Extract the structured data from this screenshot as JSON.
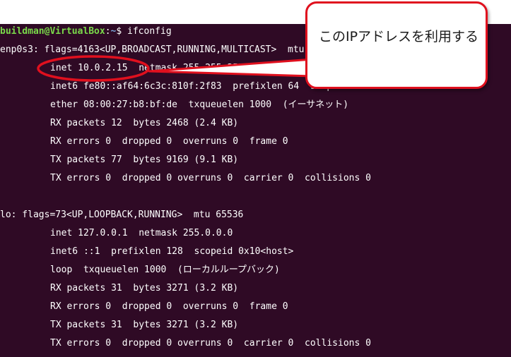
{
  "terminal": {
    "prompt_user": "buildman@VirtualBox",
    "prompt_sep": ":",
    "prompt_path": "~",
    "prompt_symbol": "$ ",
    "command": "ifconfig",
    "lines": [
      "enp0s3: flags=4163<UP,BROADCAST,RUNNING,MULTICAST>  mtu 1500",
      "inet 10.0.2.15  netmask 255.255.255.0  broadcast 10.0.2.255",
      "inet6 fe80::af64:6c3c:810f:2f83  prefixlen 64  scopeid 0x20<link>",
      "ether 08:00:27:b8:bf:de  txqueuelen 1000  (イーサネット)",
      "RX packets 12  bytes 2468 (2.4 KB)",
      "RX errors 0  dropped 0  overruns 0  frame 0",
      "TX packets 77  bytes 9169 (9.1 KB)",
      "TX errors 0  dropped 0 overruns 0  carrier 0  collisions 0",
      "",
      "lo: flags=73<UP,LOOPBACK,RUNNING>  mtu 65536",
      "inet 127.0.0.1  netmask 255.0.0.0",
      "inet6 ::1  prefixlen 128  scopeid 0x10<host>",
      "loop  txqueuelen 1000  (ローカルループバック)",
      "RX packets 31  bytes 3271 (3.2 KB)",
      "RX errors 0  dropped 0  overruns 0  frame 0",
      "TX packets 31  bytes 3271 (3.2 KB)",
      "TX errors 0  dropped 0 overruns 0  carrier 0  collisions 0"
    ]
  },
  "callout": {
    "text": "このIPアドレスを利用する"
  },
  "colors": {
    "terminal_bg": "#2f0a25",
    "prompt_user": "#7ad94a",
    "prompt_path": "#7aa6da",
    "annotation_red": "#e0101e"
  }
}
